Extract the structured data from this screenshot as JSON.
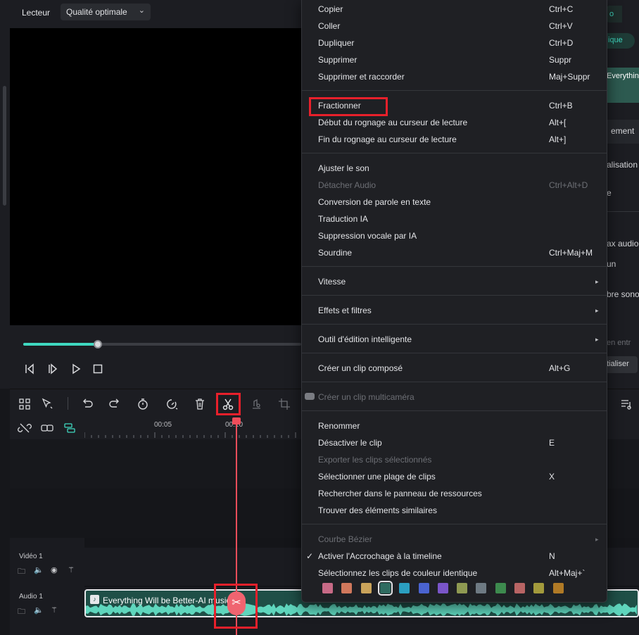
{
  "player": {
    "label": "Lecteur",
    "quality": "Qualité optimale",
    "progress": 0.27
  },
  "right_panel": {
    "tab_partial": "o",
    "button_partial": "ique",
    "thumb_partial": "Everythin",
    "section_partial": "ement",
    "row1": "alisation",
    "row2": "e",
    "row3": "ax audio",
    "row4": "un",
    "row5": "bre sono",
    "row6": "en entr",
    "reset_partial": "tialiser"
  },
  "timeline": {
    "ruler": [
      "00:05",
      "00:10"
    ],
    "tracks": [
      {
        "name": "Vidéo 1"
      },
      {
        "name": "Audio 1"
      }
    ],
    "audio_clip_title": "Everything Will be Better-AI music"
  },
  "menu": {
    "items": [
      {
        "label": "Copier",
        "shortcut": "Ctrl+C",
        "disabled": false
      },
      {
        "label": "Coller",
        "shortcut": "Ctrl+V",
        "disabled": false
      },
      {
        "label": "Dupliquer",
        "shortcut": "Ctrl+D",
        "disabled": false
      },
      {
        "label": "Supprimer",
        "shortcut": "Suppr",
        "disabled": false
      },
      {
        "label": "Supprimer et raccorder",
        "shortcut": "Maj+Suppr",
        "disabled": false
      },
      {
        "label": "Fractionner",
        "shortcut": "Ctrl+B",
        "disabled": false
      },
      {
        "label": "Début du rognage au curseur de lecture",
        "shortcut": "Alt+[",
        "disabled": false
      },
      {
        "label": "Fin du rognage au curseur de lecture",
        "shortcut": "Alt+]",
        "disabled": false
      },
      {
        "label": "Ajuster le son",
        "shortcut": "",
        "disabled": false
      },
      {
        "label": "Détacher Audio",
        "shortcut": "Ctrl+Alt+D",
        "disabled": true
      },
      {
        "label": "Conversion de parole en texte",
        "shortcut": "",
        "disabled": false
      },
      {
        "label": "Traduction IA",
        "shortcut": "",
        "disabled": false
      },
      {
        "label": "Suppression vocale par IA",
        "shortcut": "",
        "disabled": false
      },
      {
        "label": "Sourdine",
        "shortcut": "Ctrl+Maj+M",
        "disabled": false
      },
      {
        "label": "Vitesse",
        "shortcut": "",
        "disabled": false
      },
      {
        "label": "Effets et filtres",
        "shortcut": "",
        "disabled": false
      },
      {
        "label": "Outil d'édition intelligente",
        "shortcut": "",
        "disabled": false
      },
      {
        "label": "Créer un clip composé",
        "shortcut": "Alt+G",
        "disabled": false
      },
      {
        "label": "Créer un clip multicaméra",
        "shortcut": "",
        "disabled": true
      },
      {
        "label": "Renommer",
        "shortcut": "",
        "disabled": false
      },
      {
        "label": "Désactiver le clip",
        "shortcut": "E",
        "disabled": false
      },
      {
        "label": "Exporter les clips sélectionnés",
        "shortcut": "",
        "disabled": true
      },
      {
        "label": "Sélectionner une plage de clips",
        "shortcut": "X",
        "disabled": false
      },
      {
        "label": "Rechercher dans le panneau de ressources",
        "shortcut": "",
        "disabled": false
      },
      {
        "label": "Trouver des éléments similaires",
        "shortcut": "",
        "disabled": false
      },
      {
        "label": "Courbe Bézier",
        "shortcut": "",
        "disabled": true
      },
      {
        "label": "Activer l'Accrochage à la timeline",
        "shortcut": "N",
        "disabled": false
      },
      {
        "label": "Sélectionnez les clips de couleur identique",
        "shortcut": "Alt+Maj+`",
        "disabled": false
      }
    ],
    "swatches": [
      "#c76a86",
      "#d0785c",
      "#c9a35a",
      "#2f6b60",
      "#2b9fc0",
      "#4a63d0",
      "#7a55c8",
      "#8f9a52",
      "#6e7a83",
      "#3d8a4e",
      "#b86464",
      "#a39a3c",
      "#b07a26"
    ]
  }
}
